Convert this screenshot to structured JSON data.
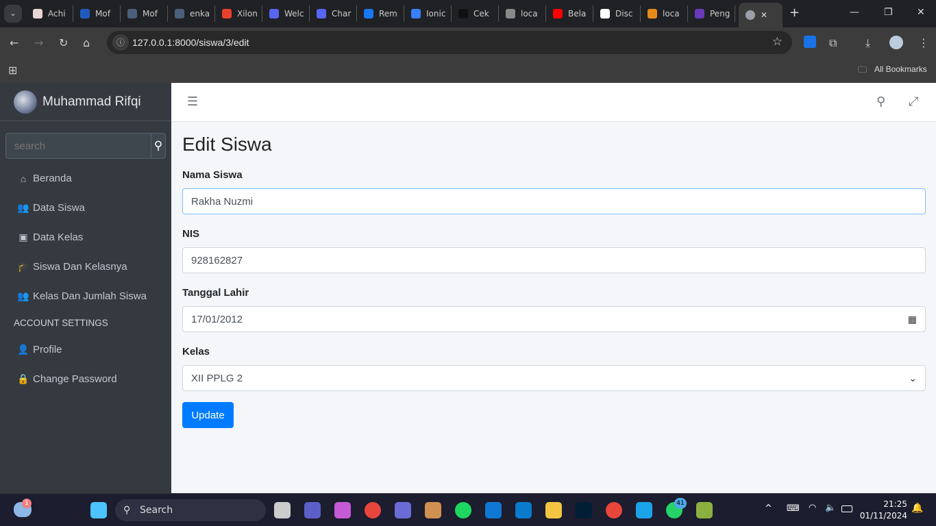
{
  "browser": {
    "tabs": [
      {
        "title": "Achi",
        "color": "#e8d6d6"
      },
      {
        "title": "Mof",
        "color": "#1f5bbf"
      },
      {
        "title": "Mof",
        "color": "#4a5f7a"
      },
      {
        "title": "enka",
        "color": "#4a5f7a"
      },
      {
        "title": "Xilon",
        "color": "#e8402a"
      },
      {
        "title": "Welc",
        "color": "#5865f2"
      },
      {
        "title": "Char",
        "color": "#5865f2"
      },
      {
        "title": "Rem",
        "color": "#1877f2"
      },
      {
        "title": "Ionic",
        "color": "#3880ff"
      },
      {
        "title": "Cek",
        "color": "#111111"
      },
      {
        "title": "loca",
        "color": "#888888"
      },
      {
        "title": "Bela",
        "color": "#ff0000"
      },
      {
        "title": "Disc",
        "color": "#ffffff"
      },
      {
        "title": "loca",
        "color": "#e88a1a"
      },
      {
        "title": "Peng",
        "color": "#673ab7"
      }
    ],
    "active_tab_close": "✕",
    "new_tab": "+",
    "url": "127.0.0.1:8000/siswa/3/edit",
    "all_bookmarks": "All Bookmarks"
  },
  "sidebar": {
    "user": "Muhammad Rifqi",
    "search_placeholder": "search",
    "items": [
      {
        "label": "Beranda",
        "icon": "⌂"
      },
      {
        "label": "Data Siswa",
        "icon": "👥"
      },
      {
        "label": "Data Kelas",
        "icon": "▣"
      },
      {
        "label": "Siswa Dan Kelasnya",
        "icon": "🎓"
      },
      {
        "label": "Kelas Dan Jumlah Siswa",
        "icon": "👥"
      }
    ],
    "section": "ACCOUNT SETTINGS",
    "account_items": [
      {
        "label": "Profile",
        "icon": "👤"
      },
      {
        "label": "Change Password",
        "icon": "🔒"
      }
    ]
  },
  "form": {
    "title": "Edit Siswa",
    "nama_label": "Nama Siswa",
    "nama_value": "Rakha Nuzmi",
    "nis_label": "NIS",
    "nis_value": "928162827",
    "tgl_label": "Tanggal Lahir",
    "tgl_value": "17/01/2012",
    "kelas_label": "Kelas",
    "kelas_value": "XII PPLG 2",
    "update": "Update"
  },
  "taskbar": {
    "search": "Search",
    "weather_badge": "1",
    "whatsapp_badge": "41",
    "time": "21:25",
    "date": "01/11/2024"
  }
}
